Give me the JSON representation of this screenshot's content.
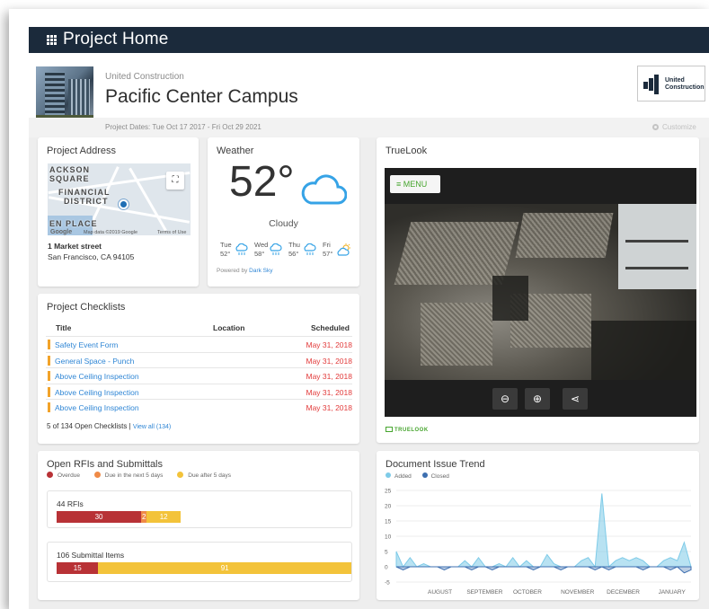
{
  "topbar": {
    "title": "Project Home",
    "icon": "grid-icon"
  },
  "header": {
    "company": "United Construction",
    "project_name": "Pacific Center Campus",
    "dates": "Project Dates: Tue Oct 17 2017 - Fri Oct 29 2021",
    "customize": "Customize",
    "logo_text_1": "United",
    "logo_text_2": "Construction"
  },
  "address": {
    "title": "Project Address",
    "street": "1 Market street",
    "city": "San Francisco, CA 94105",
    "map_labels": [
      "ACKSON",
      "SQUARE",
      "FINANCIAL",
      "DISTRICT",
      "EN PLACE"
    ],
    "map_google": "Google",
    "map_data": "Map data ©2019 Google",
    "map_terms": "Terms of Use"
  },
  "weather": {
    "title": "Weather",
    "temp": "52°",
    "condition": "Cloudy",
    "forecast": [
      {
        "day": "Tue",
        "temp": "52°",
        "icon": "rain-icon"
      },
      {
        "day": "Wed",
        "temp": "58°",
        "icon": "rain-icon"
      },
      {
        "day": "Thu",
        "temp": "56°",
        "icon": "rain-icon"
      },
      {
        "day": "Fri",
        "temp": "57°",
        "icon": "partly-sunny-icon"
      }
    ],
    "powered_prefix": "Powered by",
    "powered_link": "Dark Sky"
  },
  "truelook": {
    "title": "TrueLook",
    "menu_label": "MENU",
    "brand": "TRUELOOK",
    "controls": [
      "zoom-out-icon",
      "zoom-in-icon",
      "share-icon"
    ]
  },
  "checklists": {
    "title": "Project Checklists",
    "columns": [
      "Title",
      "Location",
      "Scheduled"
    ],
    "rows": [
      {
        "title": "Safety Event Form",
        "location": "",
        "scheduled": "May 31, 2018"
      },
      {
        "title": "General Space - Punch",
        "location": "",
        "scheduled": "May 31, 2018"
      },
      {
        "title": "Above Ceiling Inspection",
        "location": "",
        "scheduled": "May 31, 2018"
      },
      {
        "title": "Above Ceiling Inspection",
        "location": "",
        "scheduled": "May 31, 2018"
      },
      {
        "title": "Above Ceiling Inspection",
        "location": "",
        "scheduled": "May 31, 2018"
      }
    ],
    "footer": "5 of 134 Open Checklists",
    "view_all": "View all (134)",
    "colors": {
      "bar": "#f2a32a",
      "date": "#e23b3b",
      "link": "#2f86d5"
    }
  },
  "rfis": {
    "title": "Open RFIs and Submittals",
    "legend": [
      {
        "label": "Overdue",
        "color": "#b83236"
      },
      {
        "label": "Due in the next 5 days",
        "color": "#ef8a47"
      },
      {
        "label": "Due after 5 days",
        "color": "#f3c33a"
      }
    ],
    "groups": [
      {
        "label": "44 RFIs",
        "values": [
          30,
          2,
          12
        ]
      },
      {
        "label": "106 Submittal Items",
        "values": [
          15,
          0,
          91
        ]
      }
    ]
  },
  "chart_data": {
    "type": "area",
    "title": "Document Issue Trend",
    "ylim": [
      -5,
      25
    ],
    "yticks": [
      25,
      20,
      15,
      10,
      5,
      0,
      -5
    ],
    "month_labels": [
      "AUGUST",
      "SEPTEMBER",
      "OCTOBER",
      "NOVEMBER",
      "DECEMBER",
      "JANUARY"
    ],
    "x": [
      0,
      1,
      2,
      3,
      4,
      5,
      6,
      7,
      8,
      9,
      10,
      11,
      12,
      13,
      14,
      15,
      16,
      17,
      18,
      19,
      20,
      21,
      22,
      23,
      24,
      25,
      26,
      27,
      28,
      29,
      30,
      31,
      32,
      33,
      34,
      35,
      36,
      37,
      38,
      39,
      40,
      41,
      42,
      43
    ],
    "series": [
      {
        "name": "Added",
        "color": "#7ecbe8",
        "values": [
          5,
          0,
          3,
          0,
          1,
          0,
          0,
          0,
          0,
          0,
          2,
          0,
          3,
          0,
          0,
          1,
          0,
          3,
          0,
          2,
          0,
          0,
          4,
          1,
          0,
          0,
          0,
          2,
          3,
          0,
          24,
          0,
          2,
          3,
          2,
          3,
          2,
          0,
          0,
          2,
          3,
          2,
          8,
          0
        ]
      },
      {
        "name": "Closed",
        "color": "#3d6fb0",
        "values": [
          0,
          -1,
          0,
          0,
          0,
          0,
          0,
          -1,
          0,
          0,
          0,
          -1,
          0,
          0,
          -1,
          0,
          0,
          0,
          0,
          0,
          -1,
          0,
          0,
          0,
          -1,
          0,
          0,
          0,
          0,
          -1,
          0,
          -1,
          0,
          0,
          0,
          0,
          -1,
          0,
          0,
          0,
          -1,
          0,
          -2,
          -1
        ]
      }
    ]
  }
}
